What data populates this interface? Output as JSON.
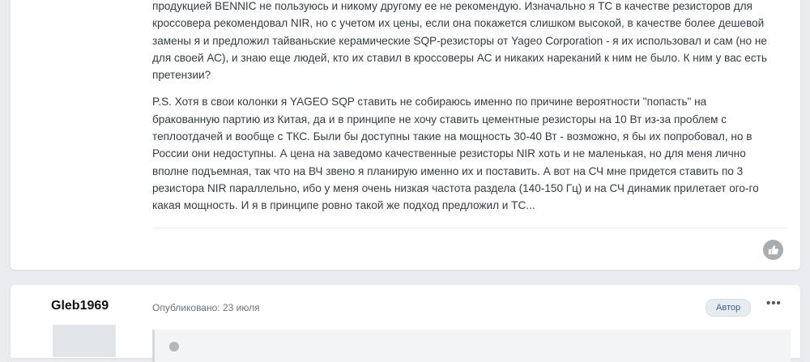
{
  "post1": {
    "paragraphs": [
      "продукцией BENNIC не пользуюсь и никому другому ее не рекомендую.  Изначально я ТС в качестве резисторов для\nкроссовера рекомендовал NIR, но с учетом их цены, если она покажется слишком высокой,  в качестве более дешевой\nзамены я и предложил тайваньские керамические SQP-резисторы от Yageo Corporation - я их использовал и сам (но не\nдля своей АС), и знаю еще людей, кто их ставил в кроссоверы АС и никаких нареканий к ним не было. К ним у вас есть\nпретензии?",
      "P.S. Хотя в свои колонки я YAGEO SQP ставить не собираюсь именно по причине вероятности \"попасть\" на\nбракованную партию из Китая, да и в принципе не хочу ставить цементные резисторы на 10 Вт из-за проблем с\nтеплоотдачей и вообще с ТКС. Были бы доступны такие на мощность 30-40 Вт - возможно, я бы их попробовал, но в\nРоссии они недоступны. А цена на заведомо качественные резисторы NIR хоть и не маленькая, но для меня лично\nвполне подъемная, так что на ВЧ звено я планирую именно их и поставить. А вот на СЧ мне придется ставить по 3\nрезистора NIR параллельно, ибо у меня очень низкая частота раздела (140-150 Гц) и на СЧ динамик прилетает ого-го\nкакая мощность. И я в принципе ровно такой же подход предложил и ТС..."
    ],
    "like_icon": "thumbs-up-icon"
  },
  "post2": {
    "author": "Gleb1969",
    "published": "Опубликовано: 23 июля",
    "badge": "Автор",
    "more": "•••"
  }
}
